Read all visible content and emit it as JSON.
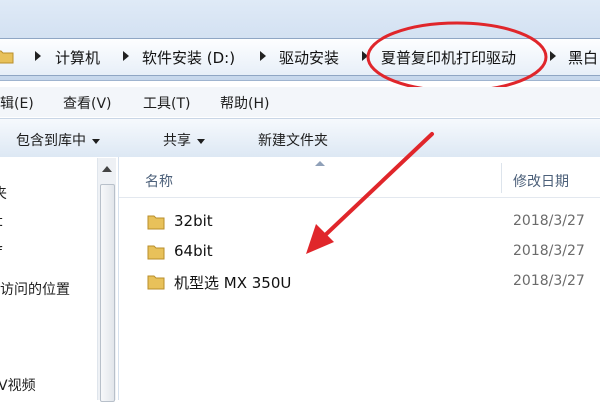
{
  "breadcrumb": {
    "items": [
      "计算机",
      "软件安装 (D:)",
      "驱动安装",
      "夏普复印机打印驱动",
      "黑白"
    ]
  },
  "menu": {
    "items": [
      "编辑(E)",
      "查看(V)",
      "工具(T)",
      "帮助(H)"
    ]
  },
  "toolbar": {
    "include_library": "包含到库中",
    "share": "共享",
    "new_folder": "新建文件夹"
  },
  "nav": {
    "items": [
      "夹",
      "t",
      "f",
      "访问的位置",
      "V视频"
    ]
  },
  "filelist": {
    "headers": {
      "name": "名称",
      "date": "修改日期"
    },
    "rows": [
      {
        "name": "32bit",
        "date": "2018/3/27"
      },
      {
        "name": "64bit",
        "date": "2018/3/27"
      },
      {
        "name": "机型选 MX 350U",
        "date": "2018/3/27"
      }
    ]
  },
  "colors": {
    "annotation": "#e0262b",
    "folder": "#e8c15a",
    "chrome": "#dfeaf7"
  },
  "icons": [
    "folder-icon",
    "chevron-right-icon",
    "chevron-down-icon",
    "scroll-up-icon"
  ]
}
